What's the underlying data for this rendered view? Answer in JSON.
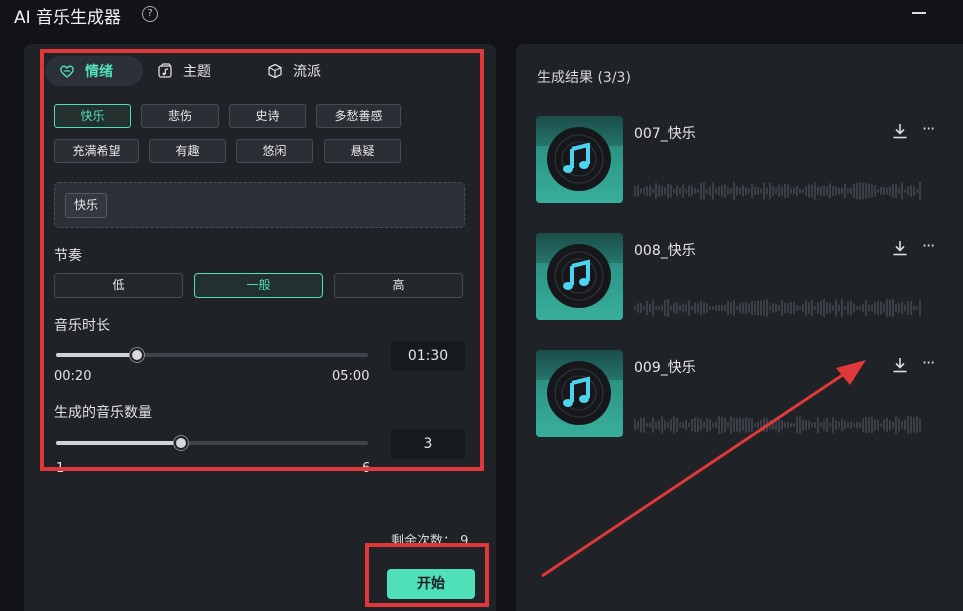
{
  "app": {
    "title": "AI 音乐生成器",
    "help_glyph": "?"
  },
  "tabs": [
    {
      "label": "情绪",
      "icon": "heart-icon",
      "active": true
    },
    {
      "label": "主题",
      "icon": "music-note-icon",
      "active": false
    },
    {
      "label": "流派",
      "icon": "cube-icon",
      "active": false
    }
  ],
  "moods": [
    {
      "label": "快乐",
      "selected": true
    },
    {
      "label": "悲伤",
      "selected": false
    },
    {
      "label": "史诗",
      "selected": false
    },
    {
      "label": "多愁善感",
      "selected": false
    },
    {
      "label": "充满希望",
      "selected": false
    },
    {
      "label": "有趣",
      "selected": false
    },
    {
      "label": "悠闲",
      "selected": false
    },
    {
      "label": "悬疑",
      "selected": false
    }
  ],
  "prompt": {
    "tag": "快乐"
  },
  "tempo": {
    "label": "节奏",
    "options": [
      {
        "label": "低",
        "selected": false
      },
      {
        "label": "一般",
        "selected": true
      },
      {
        "label": "高",
        "selected": false
      }
    ]
  },
  "duration": {
    "label": "音乐时长",
    "min": "00:20",
    "max": "05:00",
    "value": "01:30",
    "fraction": 0.26
  },
  "count": {
    "label": "生成的音乐数量",
    "min": "1",
    "max": "6",
    "value": "3",
    "fraction": 0.4
  },
  "footer": {
    "remaining_label": "剩余次数：",
    "remaining_value": "9",
    "start_label": "开始"
  },
  "results": {
    "title": "生成结果 (3/3)",
    "tracks": [
      {
        "name": "007_快乐"
      },
      {
        "name": "008_快乐"
      },
      {
        "name": "009_快乐"
      }
    ]
  },
  "colors": {
    "accent": "#4fe0b8",
    "highlight": "#e0383a",
    "panel": "#1f2227"
  }
}
